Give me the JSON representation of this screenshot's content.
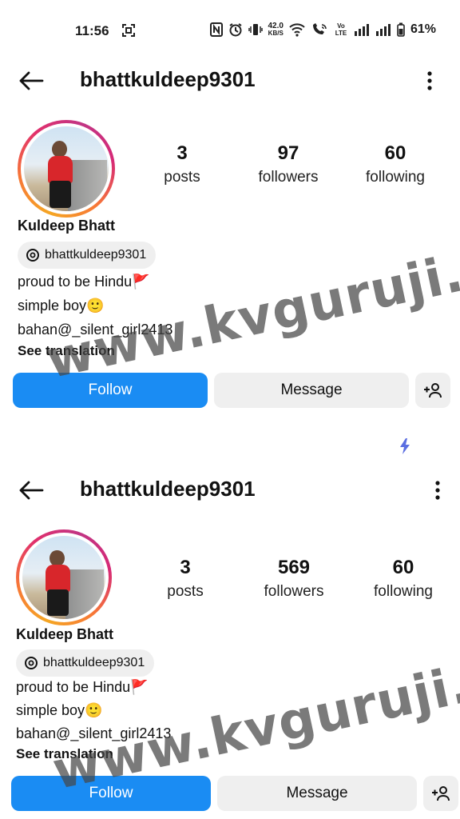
{
  "status_bar": {
    "time": "11:56",
    "network_speed_value": "42.0",
    "network_speed_unit": "KB/S",
    "volte_label": "Vo LTE",
    "battery": "61%"
  },
  "profiles": [
    {
      "username": "bhattkuldeep9301",
      "stats": {
        "posts_count": "3",
        "posts_label": "posts",
        "followers_count": "97",
        "followers_label": "followers",
        "following_count": "60",
        "following_label": "following"
      },
      "display_name": "Kuldeep Bhatt",
      "threads_handle": "bhattkuldeep9301",
      "bio": [
        "proud to be Hindu🚩",
        "simple boy🙂",
        "bahan@_silent_girl2413"
      ],
      "see_translation": "See translation",
      "buttons": {
        "follow": "Follow",
        "message": "Message"
      }
    },
    {
      "username": "bhattkuldeep9301",
      "stats": {
        "posts_count": "3",
        "posts_label": "posts",
        "followers_count": "569",
        "followers_label": "followers",
        "following_count": "60",
        "following_label": "following"
      },
      "display_name": "Kuldeep Bhatt",
      "threads_handle": "bhattkuldeep9301",
      "bio": [
        "proud to be Hindu🚩",
        "simple boy🙂",
        "bahan@_silent_girl2413"
      ],
      "see_translation": "See translation",
      "buttons": {
        "follow": "Follow",
        "message": "Message"
      }
    }
  ],
  "watermark": "www.kvguruji.com",
  "colors": {
    "follow_blue": "#1a8cf3",
    "button_gray": "#efefef",
    "bolt_blue": "#5b6ee1"
  }
}
